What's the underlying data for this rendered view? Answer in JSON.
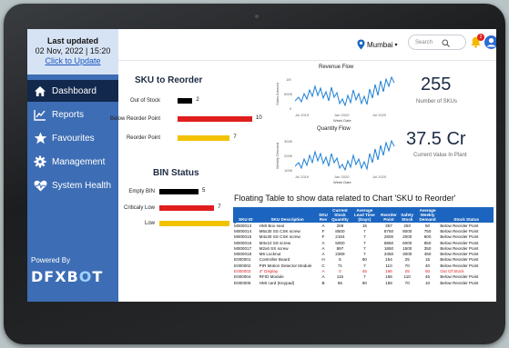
{
  "sidebar": {
    "last_updated_title": "Last updated",
    "last_updated_time": "02 Nov, 2022 | 15:20",
    "update_link": "Click to Update",
    "items": [
      {
        "label": "Dashboard",
        "icon": "home-icon",
        "active": true
      },
      {
        "label": "Reports",
        "icon": "report-chart-icon",
        "active": false
      },
      {
        "label": "Favourites",
        "icon": "star-icon",
        "active": false
      },
      {
        "label": "Management",
        "icon": "gear-icon",
        "active": false
      },
      {
        "label": "System Health",
        "icon": "heart-pulse-icon",
        "active": false
      }
    ],
    "powered_by": "Powered By",
    "logo_text": "DFXBOT"
  },
  "topbar": {
    "location": "Mumbai",
    "search_placeholder": "Search",
    "notification_count": "2",
    "colors": {
      "accent": "#1b65c0",
      "location_pin": "#1b65c0",
      "bell": "#f5b800"
    }
  },
  "charts": {
    "colors": {
      "black": "#000000",
      "red": "#e01e1e",
      "yellow": "#f2c200",
      "line": "#1b7fd6"
    },
    "revenue_flow_title": "Revenue Flow",
    "revenue_flow_ylabel": "Sales Amount",
    "revenue_flow_xlabel": "Week Date",
    "revenue_flow_xticks": [
      "Jul 2019",
      "Jan 2020",
      "Jul 2020"
    ],
    "revenue_flow_yticks": [
      "1M",
      "500K",
      "0"
    ],
    "quantity_flow_title": "Quantity Flow",
    "quantity_flow_ylabel": "Weekly Demand",
    "quantity_flow_xlabel": "Week Date",
    "quantity_flow_xticks": [
      "Jul 2019",
      "Jan 2020",
      "Jul 2020"
    ],
    "quantity_flow_yticks": [
      "300K",
      "200K",
      "100K"
    ]
  },
  "chart_data": [
    {
      "type": "bar",
      "title": "SKU to Reorder",
      "categories": [
        "Out of Stock",
        "Below Reorder Point",
        "Reorder Point"
      ],
      "values": [
        2,
        10,
        7
      ],
      "colors": [
        "#000000",
        "#e01e1e",
        "#f2c200"
      ],
      "xlim": [
        0,
        10
      ]
    },
    {
      "type": "bar",
      "title": "BIN Status",
      "categories": [
        "Empty BIN",
        "Criticaly Low",
        "Low"
      ],
      "values": [
        5,
        7,
        9
      ],
      "colors": [
        "#000000",
        "#e01e1e",
        "#f2c200"
      ],
      "xlim": [
        0,
        9
      ]
    }
  ],
  "kpis": {
    "sku_count": "255",
    "sku_count_label": "Number of SKUs",
    "stock_value": "37.5 Cr",
    "stock_value_label": "Current Value In Plant"
  },
  "table": {
    "title": "Floating Table to show data related to Chart 'SKU to Reorder'",
    "headers": [
      "SKU ID",
      "SKU Description",
      "SKU Rev",
      "Current Stock Quantity",
      "Average Lead Time (Days)",
      "Reorder Point",
      "Safety Stock",
      "Average Weekly Demand",
      "Stock Status"
    ],
    "rows": [
      [
        "M000013",
        "HMI Box seal",
        "A",
        "289",
        "15",
        "357",
        "250",
        "50",
        "Below Reorder Point"
      ],
      [
        "M000014",
        "M6x30 SS CSK screw",
        "F",
        "8500",
        "7",
        "8750",
        "8000",
        "750",
        "Below Reorder Point"
      ],
      [
        "M000015",
        "M4x30 SS CSK screw",
        "F",
        "2154",
        "7",
        "2800",
        "2000",
        "800",
        "Below Reorder Point"
      ],
      [
        "M000016",
        "M3x10 SS screw",
        "A",
        "5000",
        "7",
        "6850",
        "6000",
        "850",
        "Below Reorder Point"
      ],
      [
        "M000017",
        "M2x6 SS screw",
        "A",
        "897",
        "7",
        "1850",
        "1500",
        "350",
        "Below Reorder Point"
      ],
      [
        "M000018",
        "M6 Locknut",
        "A",
        "2369",
        "7",
        "3450",
        "3000",
        "450",
        "Below Reorder Point"
      ],
      [
        "E000001",
        "Controller Board",
        "H",
        "5",
        "60",
        "154",
        "25",
        "15",
        "Below Reorder Point"
      ],
      [
        "E000002",
        "PIR Motion Detector Module",
        "C",
        "71",
        "7",
        "110",
        "70",
        "40",
        "Below Reorder Point"
      ],
      [
        "E000003",
        "4\" Display",
        "A",
        "0",
        "45",
        "166",
        "25",
        "50",
        "Out Of Stock"
      ],
      [
        "E000004",
        "RFID Module",
        "A",
        "115",
        "7",
        "156",
        "110",
        "46",
        "Below Reorder Point"
      ],
      [
        "E000005",
        "HMI card (Keypad)",
        "B",
        "65",
        "60",
        "156",
        "70",
        "10",
        "Below Reorder Point"
      ]
    ]
  }
}
